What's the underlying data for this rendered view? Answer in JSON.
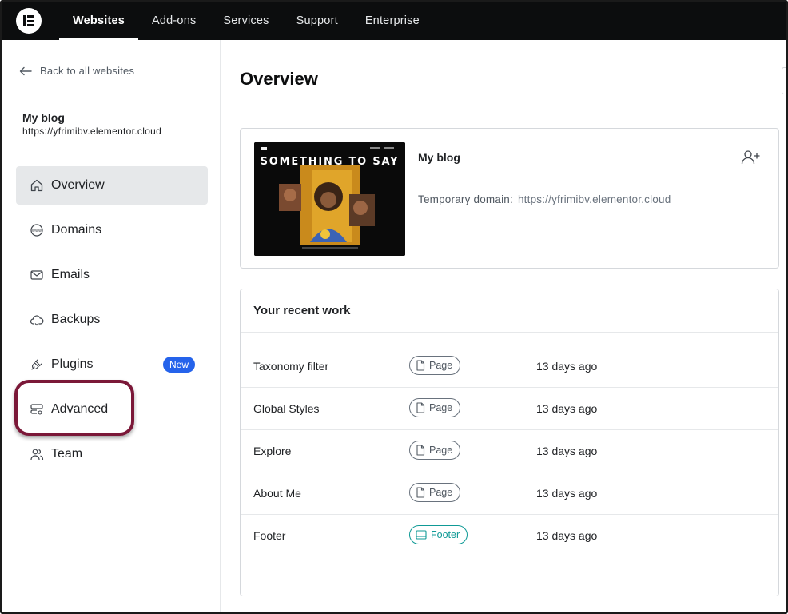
{
  "nav": {
    "tabs": [
      {
        "label": "Websites",
        "active": true
      },
      {
        "label": "Add-ons"
      },
      {
        "label": "Services"
      },
      {
        "label": "Support"
      },
      {
        "label": "Enterprise"
      }
    ]
  },
  "sidebar": {
    "back_label": "Back to all websites",
    "site_name": "My blog",
    "site_url": "https://yfrimibv.elementor.cloud",
    "items": [
      {
        "label": "Overview",
        "icon": "home-icon",
        "active": true
      },
      {
        "label": "Domains",
        "icon": "www-globe-icon"
      },
      {
        "label": "Emails",
        "icon": "mail-icon"
      },
      {
        "label": "Backups",
        "icon": "cloud-backup-icon"
      },
      {
        "label": "Plugins",
        "icon": "plug-icon",
        "badge": "New"
      },
      {
        "label": "Advanced",
        "icon": "server-settings-icon"
      },
      {
        "label": "Team",
        "icon": "users-icon"
      }
    ]
  },
  "main": {
    "title": "Overview",
    "site_card": {
      "thumbnail_text": "SOMETHING TO SAY",
      "name": "My blog",
      "temp_domain_label": "Temporary domain:",
      "temp_domain_url": "https://yfrimibv.elementor.cloud"
    },
    "recent": {
      "title": "Your recent work",
      "rows": [
        {
          "name": "Taxonomy filter",
          "type": "Page",
          "time": "13 days ago"
        },
        {
          "name": "Global Styles",
          "type": "Page",
          "time": "13 days ago"
        },
        {
          "name": "Explore",
          "type": "Page",
          "time": "13 days ago"
        },
        {
          "name": "About Me",
          "type": "Page",
          "time": "13 days ago"
        },
        {
          "name": "Footer",
          "type": "Footer",
          "time": "13 days ago"
        }
      ]
    }
  },
  "colors": {
    "nav_bg": "#0c0d0e",
    "badge_blue": "#2563eb",
    "highlight": "#7b1838",
    "footer_teal": "#0f9a96"
  }
}
